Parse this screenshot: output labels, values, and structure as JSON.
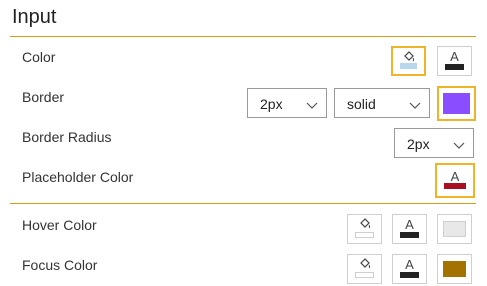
{
  "section": {
    "title": "Input"
  },
  "rows": {
    "color": {
      "label": "Color"
    },
    "border": {
      "label": "Border",
      "width_value": "2px",
      "style_value": "solid",
      "color": "#8a4dff"
    },
    "border_radius": {
      "label": "Border Radius",
      "value": "2px"
    },
    "placeholder_color": {
      "label": "Placeholder Color",
      "font_glyph": "A",
      "color": "#a80f22"
    },
    "hover_color": {
      "label": "Hover Color",
      "font_glyph": "A",
      "color": "#e8e8e8"
    },
    "focus_color": {
      "label": "Focus Color",
      "font_glyph": "A",
      "color": "#a37300"
    }
  },
  "color_row": {
    "font_glyph": "A",
    "fill_color": "#b9d7ea",
    "font_color": "#222222"
  },
  "colors": {
    "accent": "#f0b429",
    "divider": "#d4a017"
  }
}
